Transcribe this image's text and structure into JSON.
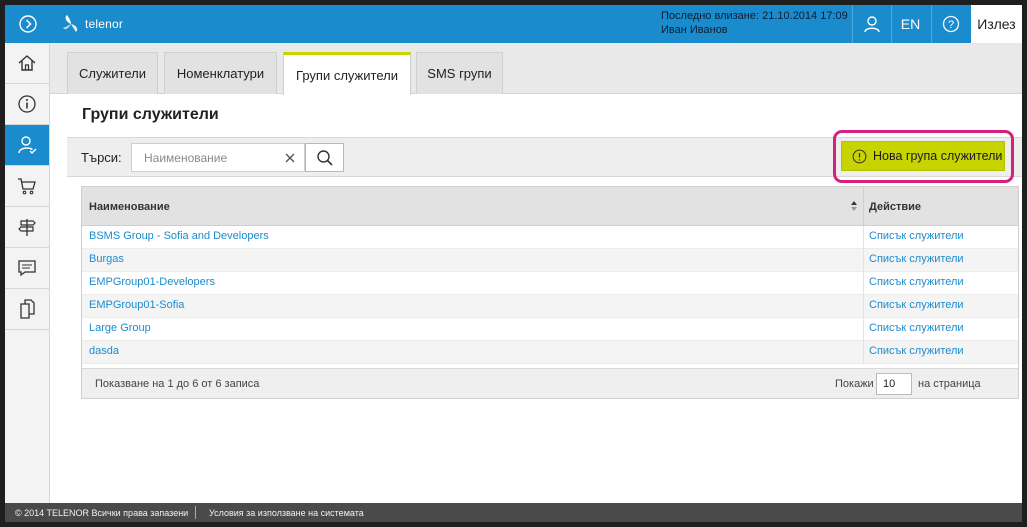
{
  "header": {
    "brand": "telenor",
    "last_login_label": "Последно влизане: 21.10.2014 17:09",
    "user_name": "Иван Иванов",
    "lang": "EN",
    "logout": "Излез",
    "accent": "#1a8ccd"
  },
  "sidebar": {
    "items": [
      {
        "icon": "home-icon"
      },
      {
        "icon": "info-icon"
      },
      {
        "icon": "employee-icon",
        "active": true
      },
      {
        "icon": "cart-icon"
      },
      {
        "icon": "signpost-icon"
      },
      {
        "icon": "chat-icon"
      },
      {
        "icon": "documents-icon"
      }
    ]
  },
  "tabs": [
    {
      "label": "Служители"
    },
    {
      "label": "Номенклатури"
    },
    {
      "label": "Групи служители",
      "active": true
    },
    {
      "label": "SMS групи"
    }
  ],
  "page": {
    "title": "Групи служители"
  },
  "toolbar": {
    "search_label": "Търси:",
    "search_placeholder": "Наименование",
    "new_group_label": "Нова група служители",
    "new_group_color": "#c8d400"
  },
  "table": {
    "headers": {
      "name": "Наименование",
      "action": "Действие"
    },
    "rows": [
      {
        "name": "BSMS Group - Sofia and Developers",
        "action": "Списък служители"
      },
      {
        "name": "Burgas",
        "action": "Списък служители"
      },
      {
        "name": "EMPGroup01-Developers",
        "action": "Списък служители"
      },
      {
        "name": "EMPGroup01-Sofia",
        "action": "Списък служители"
      },
      {
        "name": "Large Group",
        "action": "Списък служители"
      },
      {
        "name": "dasda",
        "action": "Списък служители"
      }
    ],
    "paging_info": "Показване на 1 до 6 от 6 записа",
    "show_label": "Покажи",
    "page_size": "10",
    "per_page_label": "на страница"
  },
  "footer": {
    "copyright": "© 2014 TELENOR Всички права запазени",
    "terms": "Условия за използване на системата"
  }
}
